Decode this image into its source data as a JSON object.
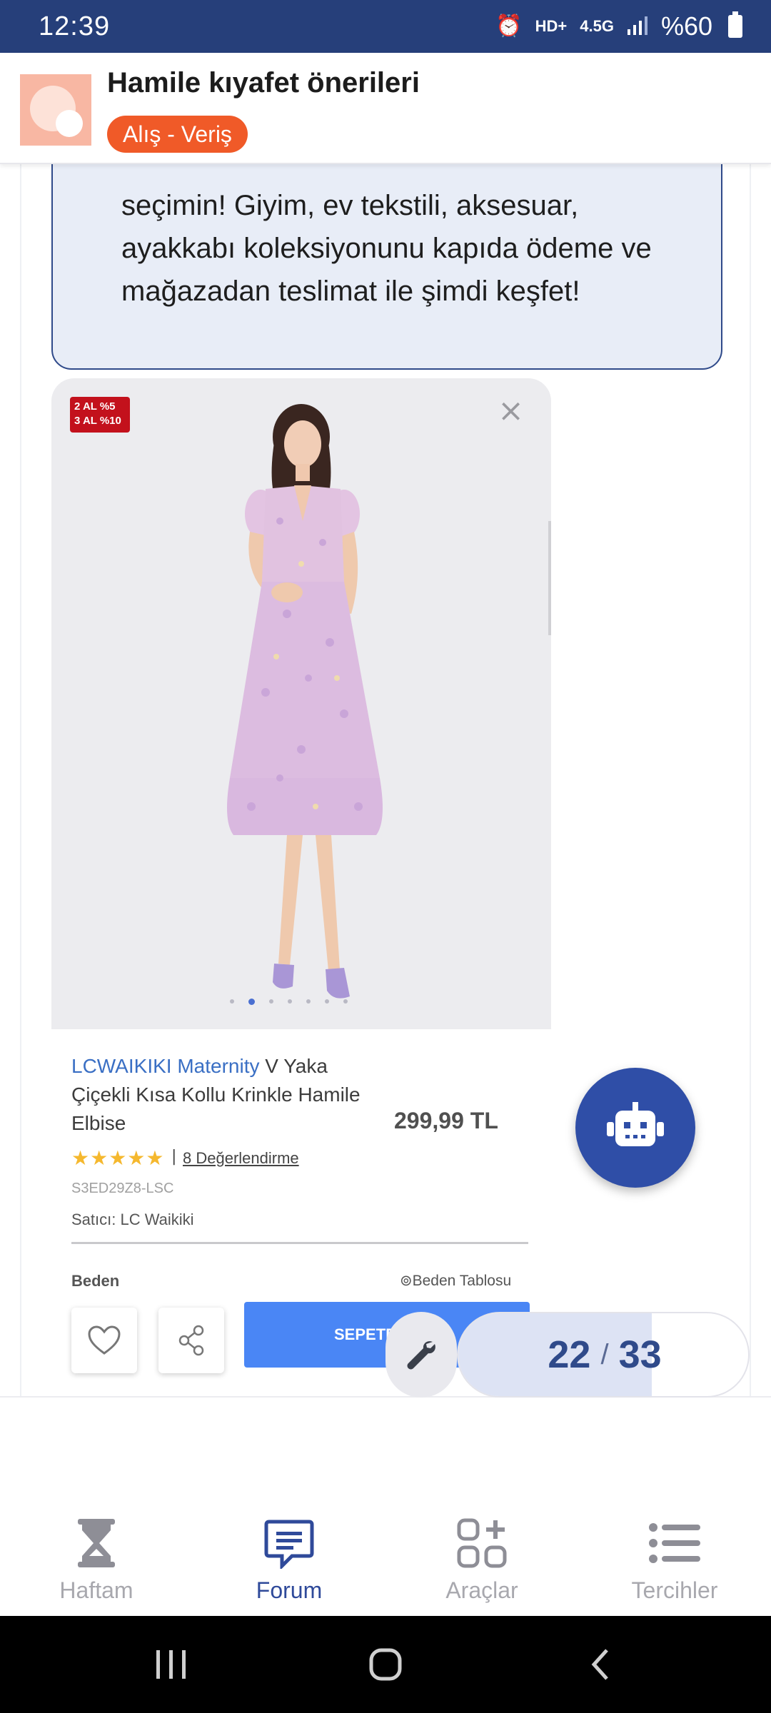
{
  "status_bar": {
    "time": "12:39",
    "alarm_icon": "alarm-icon",
    "hd_label": "HD+",
    "network_label": "4.5G",
    "battery_text": "%60"
  },
  "header": {
    "title": "Hamile kıyafet önerileri",
    "category": "Alış - Veriş"
  },
  "post": {
    "quote_text": "seçimin! Giyim, ev tekstili, aksesuar, ayakkabı koleksiyonunu kapıda ödeme ve mağazadan teslimat ile şimdi keşfet!"
  },
  "product": {
    "promo_line1": "2 AL %5",
    "promo_line2": "3 AL %10",
    "brand": "LCWAIKIKI Maternity",
    "name": " V Yaka Çiçekli Kısa Kollu Krinkle Hamile Elbise",
    "price": "299,99 TL",
    "stars": "★★★★★",
    "reviews_sep": "|",
    "reviews": "8 Değerlendirme",
    "sku": "S3ED29Z8-LSC",
    "seller": "Satıcı:  LC Waikiki",
    "size_label": "Beden",
    "size_table": "⊚Beden Tablosu",
    "cart_label": "SEPETE",
    "image_dots": 8,
    "active_dot": 1
  },
  "pager": {
    "current": "22",
    "separator": "/",
    "total": "33",
    "progress": 0.6667
  },
  "nav": {
    "items": [
      {
        "label": "Haftam",
        "icon": "hourglass-icon"
      },
      {
        "label": "Forum",
        "icon": "chat-icon"
      },
      {
        "label": "Araçlar",
        "icon": "tools-grid-icon"
      },
      {
        "label": "Tercihler",
        "icon": "list-icon"
      }
    ],
    "active_index": 1
  },
  "colors": {
    "primary": "#2f4a9a",
    "status_bar": "#263f7a",
    "category_chip": "#f05a28",
    "cart_button": "#4a86f5"
  }
}
